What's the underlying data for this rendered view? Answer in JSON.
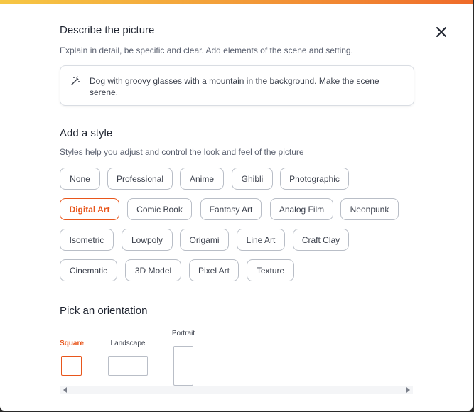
{
  "header": {
    "title": "Describe the picture",
    "subtitle": "Explain in detail, be specific and clear. Add elements of the scene and setting."
  },
  "prompt": {
    "icon": "magic-wand-icon",
    "text": "Dog with groovy glasses with a mountain in the background. Make the scene serene."
  },
  "style_section": {
    "title": "Add a style",
    "subtitle": "Styles help you adjust and control the look and feel of the picture",
    "selected": "Digital Art",
    "styles": [
      "None",
      "Professional",
      "Anime",
      "Ghibli",
      "Photographic",
      "Digital Art",
      "Comic Book",
      "Fantasy Art",
      "Analog Film",
      "Neonpunk",
      "Isometric",
      "Lowpoly",
      "Origami",
      "Line Art",
      "Craft Clay",
      "Cinematic",
      "3D Model",
      "Pixel Art",
      "Texture"
    ]
  },
  "orientation_section": {
    "title": "Pick an orientation",
    "selected": "Square",
    "options": [
      "Square",
      "Landscape",
      "Portrait"
    ]
  },
  "colors": {
    "accent": "#e8561c",
    "border": "#b9bec7",
    "text": "#3a3f4b"
  },
  "icons": {
    "close": "close-icon",
    "scroll_left": "chevron-left-icon",
    "scroll_right": "chevron-right-icon"
  }
}
